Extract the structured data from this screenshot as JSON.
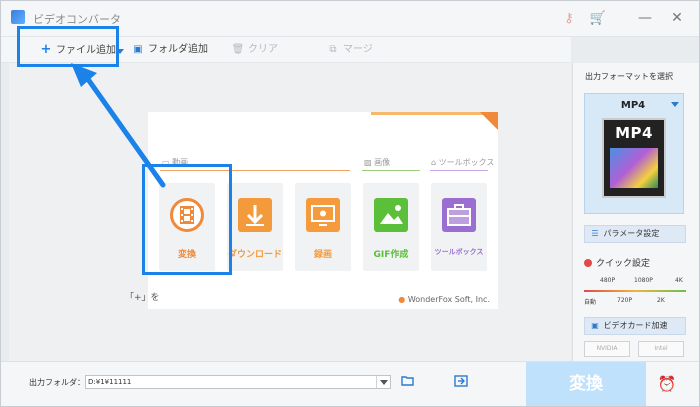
{
  "window": {
    "title": "ビデオコンバータ"
  },
  "toolbar": {
    "add_file": "ファイル追加",
    "add_folder": "フォルダ追加",
    "clear": "クリア",
    "merge": "マージ"
  },
  "welcome": {
    "sections": {
      "video": "動画",
      "image": "画像",
      "toolbox": "ツールボックス"
    },
    "cards": {
      "convert": "変換",
      "download": "ダウンロード",
      "record": "録画",
      "gif": "GIF作成",
      "toolbox": "ツールボックス"
    },
    "brand": "WonderFox Soft, Inc.",
    "hint": "「+」を"
  },
  "sidebar": {
    "title": "出力フォーマットを選択",
    "format": "MP4",
    "format_art_label": "MP4",
    "params_button": "パラメータ設定",
    "quick_settings": "クイック設定",
    "quality_top": [
      "480P",
      "1080P",
      "4K"
    ],
    "quality_bottom": [
      "自動",
      "720P",
      "2K"
    ],
    "gpu_accel": "ビデオカード加速",
    "nvidia": "NVIDIA",
    "intel": "Intel"
  },
  "bottom": {
    "output_folder_label": "出力フォルダ：",
    "output_path": "D:¥1¥11111",
    "convert_button": "変換"
  },
  "colors": {
    "accent": "#1a82e8",
    "convert_bg": "#bfe1fb",
    "convert_card": "#f08a3a",
    "download_card": "#f29a3c",
    "record_card": "#f59b3d",
    "gif_card": "#5bbf3a",
    "toolbox_card": "#9b6ed1",
    "section_video": "#f2a15e",
    "section_image": "#9bd07a",
    "section_toolbox": "#c9a8e8"
  },
  "icons": [
    "plus-icon",
    "dropdown-arrow-icon",
    "folder-add-icon",
    "trash-icon",
    "merge-icon",
    "key-icon",
    "cart-icon",
    "minimize-icon",
    "close-icon",
    "film-icon",
    "download-icon",
    "screen-record-icon",
    "image-icon",
    "toolbox-icon",
    "settings-sliders-icon",
    "gpu-icon",
    "folder-open-icon",
    "folder-export-icon",
    "alarm-clock-icon"
  ]
}
